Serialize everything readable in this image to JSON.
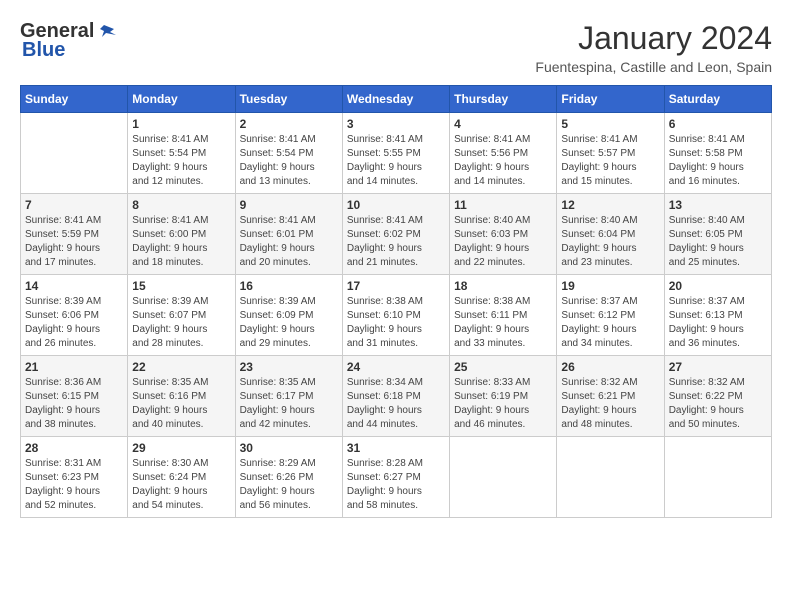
{
  "logo": {
    "general": "General",
    "blue": "Blue"
  },
  "title": {
    "month_year": "January 2024",
    "location": "Fuentespina, Castille and Leon, Spain"
  },
  "headers": [
    "Sunday",
    "Monday",
    "Tuesday",
    "Wednesday",
    "Thursday",
    "Friday",
    "Saturday"
  ],
  "weeks": [
    [
      {
        "day": "",
        "info": ""
      },
      {
        "day": "1",
        "info": "Sunrise: 8:41 AM\nSunset: 5:54 PM\nDaylight: 9 hours\nand 12 minutes."
      },
      {
        "day": "2",
        "info": "Sunrise: 8:41 AM\nSunset: 5:54 PM\nDaylight: 9 hours\nand 13 minutes."
      },
      {
        "day": "3",
        "info": "Sunrise: 8:41 AM\nSunset: 5:55 PM\nDaylight: 9 hours\nand 14 minutes."
      },
      {
        "day": "4",
        "info": "Sunrise: 8:41 AM\nSunset: 5:56 PM\nDaylight: 9 hours\nand 14 minutes."
      },
      {
        "day": "5",
        "info": "Sunrise: 8:41 AM\nSunset: 5:57 PM\nDaylight: 9 hours\nand 15 minutes."
      },
      {
        "day": "6",
        "info": "Sunrise: 8:41 AM\nSunset: 5:58 PM\nDaylight: 9 hours\nand 16 minutes."
      }
    ],
    [
      {
        "day": "7",
        "info": "Sunrise: 8:41 AM\nSunset: 5:59 PM\nDaylight: 9 hours\nand 17 minutes."
      },
      {
        "day": "8",
        "info": "Sunrise: 8:41 AM\nSunset: 6:00 PM\nDaylight: 9 hours\nand 18 minutes."
      },
      {
        "day": "9",
        "info": "Sunrise: 8:41 AM\nSunset: 6:01 PM\nDaylight: 9 hours\nand 20 minutes."
      },
      {
        "day": "10",
        "info": "Sunrise: 8:41 AM\nSunset: 6:02 PM\nDaylight: 9 hours\nand 21 minutes."
      },
      {
        "day": "11",
        "info": "Sunrise: 8:40 AM\nSunset: 6:03 PM\nDaylight: 9 hours\nand 22 minutes."
      },
      {
        "day": "12",
        "info": "Sunrise: 8:40 AM\nSunset: 6:04 PM\nDaylight: 9 hours\nand 23 minutes."
      },
      {
        "day": "13",
        "info": "Sunrise: 8:40 AM\nSunset: 6:05 PM\nDaylight: 9 hours\nand 25 minutes."
      }
    ],
    [
      {
        "day": "14",
        "info": "Sunrise: 8:39 AM\nSunset: 6:06 PM\nDaylight: 9 hours\nand 26 minutes."
      },
      {
        "day": "15",
        "info": "Sunrise: 8:39 AM\nSunset: 6:07 PM\nDaylight: 9 hours\nand 28 minutes."
      },
      {
        "day": "16",
        "info": "Sunrise: 8:39 AM\nSunset: 6:09 PM\nDaylight: 9 hours\nand 29 minutes."
      },
      {
        "day": "17",
        "info": "Sunrise: 8:38 AM\nSunset: 6:10 PM\nDaylight: 9 hours\nand 31 minutes."
      },
      {
        "day": "18",
        "info": "Sunrise: 8:38 AM\nSunset: 6:11 PM\nDaylight: 9 hours\nand 33 minutes."
      },
      {
        "day": "19",
        "info": "Sunrise: 8:37 AM\nSunset: 6:12 PM\nDaylight: 9 hours\nand 34 minutes."
      },
      {
        "day": "20",
        "info": "Sunrise: 8:37 AM\nSunset: 6:13 PM\nDaylight: 9 hours\nand 36 minutes."
      }
    ],
    [
      {
        "day": "21",
        "info": "Sunrise: 8:36 AM\nSunset: 6:15 PM\nDaylight: 9 hours\nand 38 minutes."
      },
      {
        "day": "22",
        "info": "Sunrise: 8:35 AM\nSunset: 6:16 PM\nDaylight: 9 hours\nand 40 minutes."
      },
      {
        "day": "23",
        "info": "Sunrise: 8:35 AM\nSunset: 6:17 PM\nDaylight: 9 hours\nand 42 minutes."
      },
      {
        "day": "24",
        "info": "Sunrise: 8:34 AM\nSunset: 6:18 PM\nDaylight: 9 hours\nand 44 minutes."
      },
      {
        "day": "25",
        "info": "Sunrise: 8:33 AM\nSunset: 6:19 PM\nDaylight: 9 hours\nand 46 minutes."
      },
      {
        "day": "26",
        "info": "Sunrise: 8:32 AM\nSunset: 6:21 PM\nDaylight: 9 hours\nand 48 minutes."
      },
      {
        "day": "27",
        "info": "Sunrise: 8:32 AM\nSunset: 6:22 PM\nDaylight: 9 hours\nand 50 minutes."
      }
    ],
    [
      {
        "day": "28",
        "info": "Sunrise: 8:31 AM\nSunset: 6:23 PM\nDaylight: 9 hours\nand 52 minutes."
      },
      {
        "day": "29",
        "info": "Sunrise: 8:30 AM\nSunset: 6:24 PM\nDaylight: 9 hours\nand 54 minutes."
      },
      {
        "day": "30",
        "info": "Sunrise: 8:29 AM\nSunset: 6:26 PM\nDaylight: 9 hours\nand 56 minutes."
      },
      {
        "day": "31",
        "info": "Sunrise: 8:28 AM\nSunset: 6:27 PM\nDaylight: 9 hours\nand 58 minutes."
      },
      {
        "day": "",
        "info": ""
      },
      {
        "day": "",
        "info": ""
      },
      {
        "day": "",
        "info": ""
      }
    ]
  ]
}
